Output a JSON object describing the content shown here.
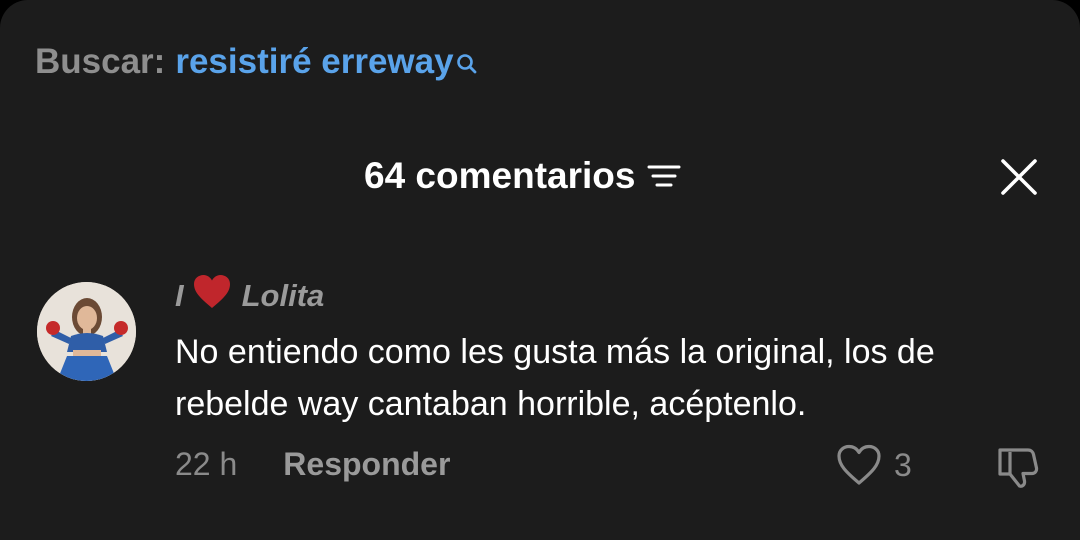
{
  "search": {
    "prefix": "Buscar:",
    "query": "resistiré erreway",
    "icon": "search-icon",
    "query_color": "#5aa3ea"
  },
  "header": {
    "title": "64 comentarios",
    "filter_icon": "filter-icon",
    "close_icon": "close-icon"
  },
  "comment": {
    "author_prefix": "I",
    "author_emoji": "heart-icon",
    "author_name": "Lolita",
    "text": "No entiendo como les gusta más la original, los de rebelde way cantaban horrible, acéptenlo.",
    "time": "22 h",
    "reply_label": "Responder",
    "like_count": "3",
    "like_icon": "heart-outline-icon",
    "dislike_icon": "thumbs-down-icon"
  },
  "colors": {
    "background": "#1c1c1c",
    "heart": "#c0262c"
  }
}
